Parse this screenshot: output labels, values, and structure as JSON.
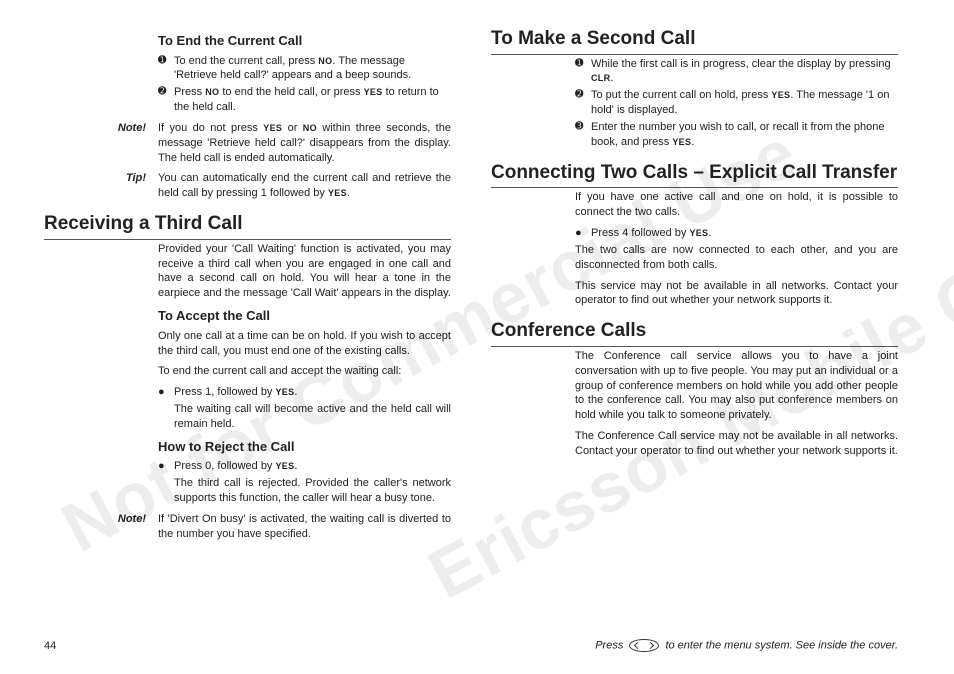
{
  "watermarks": {
    "wm1": "Not for Commercial Use",
    "wm2": "Ericsson Mobile Communications AB"
  },
  "left": {
    "s1": {
      "title": "To End the Current Call",
      "n1": "To end the current call, press <b class='sc'>NO</b>. The message 'Retrieve held call?' appears and a beep sounds.",
      "n2": "Press <b class='sc'>NO</b> to end the held call, or press <b class='sc'>YES</b> to return to the held call."
    },
    "note1": {
      "label": "Note!",
      "body": "If you do not press <b class='sc'>YES</b> or <b class='sc'>NO</b> within three seconds, the message 'Retrieve held call?' disappears from the display. The held call is ended automatically."
    },
    "tip1": {
      "label": "Tip!",
      "body": "You can automatically end the current call and retrieve the held call by pressing 1 followed by <b class='sc'>YES</b>."
    },
    "h2a": "Receiving a Third Call",
    "p1": "Provided your 'Call Waiting' function is activated, you may receive a third call when you are engaged in one call and have a second call on hold. You will hear a tone in the earpiece and the message 'Call Wait' appears in the display.",
    "s2": {
      "title": "To Accept the Call",
      "p": "Only one call at a time can be on hold. If you wish to accept the third call, you must end one of the existing calls.",
      "p2": "To end the current call and accept the waiting call:",
      "b1": "Press 1, followed by <b class='sc'>YES</b>.",
      "sub": "The waiting call will become active and the held call will remain held."
    },
    "s3": {
      "title": "How to Reject the Call",
      "b1": "Press 0, followed by <b class='sc'>YES</b>.",
      "sub": "The third call is rejected. Provided the caller's network supports this function, the caller will hear a busy tone."
    },
    "note2": {
      "label": "Note!",
      "body": "If 'Divert On busy' is activated, the waiting call is diverted to the number you have specified."
    }
  },
  "right": {
    "h2a": "To Make a Second Call",
    "n1": "While the first call is in progress, clear the display by pressing <b class='sc'>CLR</b>.",
    "n2": "To put the current call on hold, press <b class='sc'>YES</b>. The message '1 on hold' is displayed.",
    "n3": "Enter the number you wish to call, or recall it from the phone book, and press <b class='sc'>YES</b>.",
    "h2b": "Connecting Two Calls – Explicit Call Transfer",
    "p1": "If you have one active call and one on hold, it is possible to connect the two calls.",
    "b1": "Press 4 followed by <b class='sc'>YES</b>.",
    "p2": "The two calls are now connected to each other, and you are disconnected from both calls.",
    "p3": "This service may not be available in all networks. Contact your operator to find out whether your net­work supports it.",
    "h2c": "Conference Calls",
    "p4": "The Conference call service allows you to have a joint conversation with up to five people. You may put an individual or a group of conference members on hold while you add other people to the conference call. You may also put conference members on hold while you talk to someone privately.",
    "p5": "The Conference Call service may not be available in all networks. Contact your operator to find out whether your network supports it."
  },
  "footer": {
    "page": "44",
    "hint_pre": "Press ",
    "hint_post": " to enter the menu system. See inside the cover."
  }
}
